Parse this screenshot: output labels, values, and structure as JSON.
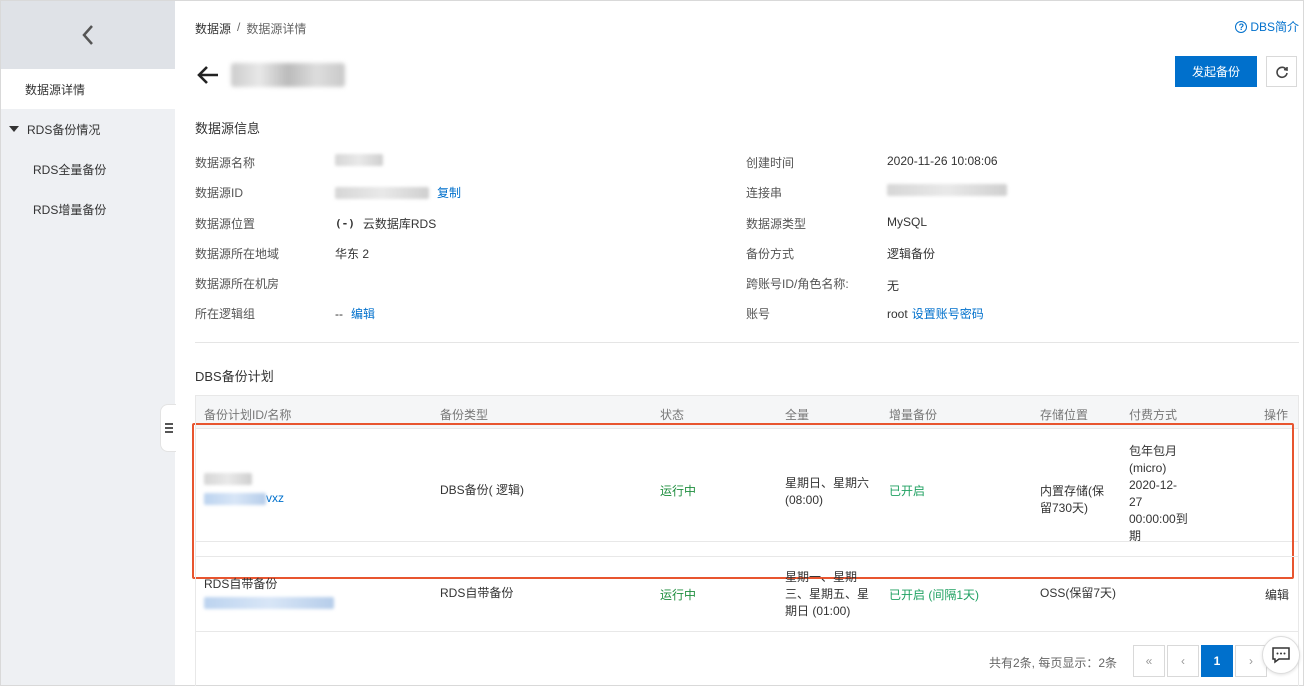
{
  "breadcrumb": {
    "root": "数据源",
    "separator": "/",
    "current": "数据源详情"
  },
  "help_link": "DBS简介",
  "buttons": {
    "start_backup": "发起备份"
  },
  "sidebar": {
    "items": [
      {
        "label": "数据源详情"
      },
      {
        "label": "RDS备份情况"
      },
      {
        "label": "RDS全量备份"
      },
      {
        "label": "RDS增量备份"
      }
    ]
  },
  "sections": {
    "info_title": "数据源信息",
    "plan_title": "DBS备份计划"
  },
  "info": {
    "name_label": "数据源名称",
    "id_label": "数据源ID",
    "copy_link": "复制",
    "location_label": "数据源位置",
    "location_icon": "(-)",
    "location_value": "云数据库RDS",
    "region_label": "数据源所在地域",
    "region_value": "华东 2",
    "room_label": "数据源所在机房",
    "group_label": "所在逻辑组",
    "group_value": "--",
    "group_edit": "编辑",
    "created_label": "创建时间",
    "created_value": "2020-11-26 10:08:06",
    "conn_label": "连接串",
    "type_label": "数据源类型",
    "type_value": "MySQL",
    "method_label": "备份方式",
    "method_value": "逻辑备份",
    "cross_label": "跨账号ID/角色名称:",
    "cross_value": "无",
    "account_label": "账号",
    "account_value": "root",
    "account_link": "设置账号密码"
  },
  "table": {
    "headers": [
      "备份计划ID/名称",
      "备份类型",
      "状态",
      "全量",
      "增量备份",
      "存储位置",
      "付费方式",
      "操作"
    ],
    "rows": [
      {
        "id_suffix": "vxz",
        "type": "DBS备份( 逻辑)",
        "status": "运行中",
        "full_line1": "星期日、星期六",
        "full_line2": "(08:00)",
        "incremental": "已开启",
        "storage_line1": "内置存储(保",
        "storage_line2": "留730天)",
        "pay_lines": [
          "包年包月",
          "(micro)",
          "2020-12-",
          "27",
          "00:00:00到",
          "期"
        ],
        "action": ""
      },
      {
        "name": "RDS自带备份",
        "type": "RDS自带备份",
        "status": "运行中",
        "full_lines": [
          "星期一、星期",
          "三、星期五、星",
          "期日 (01:00)"
        ],
        "incremental": "已开启 (间隔1天)",
        "storage": "OSS(保留7天)",
        "action": "编辑"
      }
    ]
  },
  "pagination": {
    "info": "共有2条, 每页显示：2条",
    "first": "«",
    "prev": "‹",
    "current": "1",
    "next": "›",
    "last": "»"
  },
  "icons": [
    "chevron-left-icon",
    "back-arrow-icon",
    "refresh-icon",
    "help-icon",
    "caret-down-icon",
    "collapse-icon",
    "chat-icon"
  ]
}
